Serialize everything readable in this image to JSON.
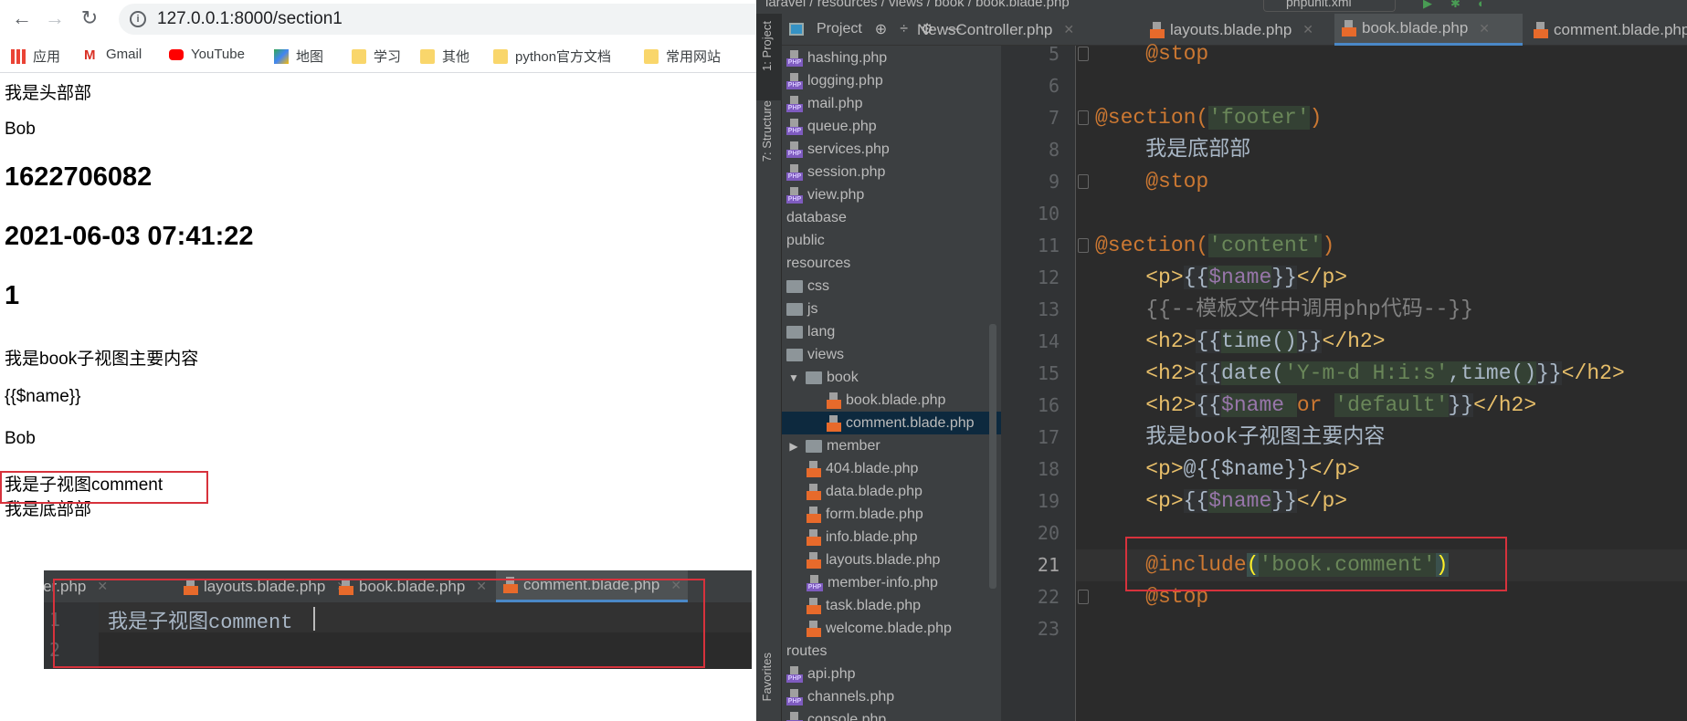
{
  "browser": {
    "url": "127.0.0.1:8000/section1",
    "bookmarks": [
      {
        "label": "应用",
        "icon": "apps-grid-icon"
      },
      {
        "label": "Gmail",
        "icon": "gmail-icon"
      },
      {
        "label": "YouTube",
        "icon": "youtube-icon"
      },
      {
        "label": "地图",
        "icon": "maps-icon"
      },
      {
        "label": "学习",
        "icon": "folder-icon"
      },
      {
        "label": "其他",
        "icon": "folder-icon"
      },
      {
        "label": "python官方文档",
        "icon": "folder-icon"
      },
      {
        "label": "常用网站",
        "icon": "folder-icon"
      }
    ],
    "page": [
      {
        "text": "我是头部部",
        "tag": "p"
      },
      {
        "text": "Bob",
        "tag": "p"
      },
      {
        "text": "1622706082",
        "tag": "h2"
      },
      {
        "text": "2021-06-03 07:41:22",
        "tag": "h2"
      },
      {
        "text": "1",
        "tag": "h2"
      },
      {
        "text": "我是book子视图主要内容",
        "tag": "p"
      },
      {
        "text": "{{$name}}",
        "tag": "p"
      },
      {
        "text": "Bob",
        "tag": "p"
      },
      {
        "text": "我是子视图comment",
        "tag": "p"
      },
      {
        "text": "我是底部部",
        "tag": "p"
      }
    ]
  },
  "snippet": {
    "tabs": [
      {
        "label": "NewsController.php",
        "type": "php"
      },
      {
        "label": "layouts.blade.php",
        "type": "blade"
      },
      {
        "label": "book.blade.php",
        "type": "blade"
      },
      {
        "label": "comment.blade.php",
        "type": "blade",
        "active": true
      }
    ],
    "lines": [
      {
        "num": "1",
        "text": "我是子视图comment"
      },
      {
        "num": "2",
        "text": ""
      }
    ]
  },
  "ide": {
    "breadcrumbs": "laravel / resources / views / book / book.blade.php",
    "run_config": "phpunit.xml",
    "side_tools": [
      "1: Project",
      "7: Structure",
      "Favorites"
    ],
    "pane_title": "Project",
    "tree": [
      {
        "label": "hashing.php",
        "type": "php",
        "depth": 0
      },
      {
        "label": "logging.php",
        "type": "php",
        "depth": 0
      },
      {
        "label": "mail.php",
        "type": "php",
        "depth": 0
      },
      {
        "label": "queue.php",
        "type": "php",
        "depth": 0
      },
      {
        "label": "services.php",
        "type": "php",
        "depth": 0
      },
      {
        "label": "session.php",
        "type": "php",
        "depth": 0
      },
      {
        "label": "view.php",
        "type": "php",
        "depth": 0
      },
      {
        "label": "database",
        "type": "plain",
        "depth": 0
      },
      {
        "label": "public",
        "type": "plain",
        "depth": 0
      },
      {
        "label": "resources",
        "type": "plain",
        "depth": 0
      },
      {
        "label": "css",
        "type": "folder",
        "depth": 0
      },
      {
        "label": "js",
        "type": "folder",
        "depth": 0
      },
      {
        "label": "lang",
        "type": "folder",
        "depth": 0
      },
      {
        "label": "views",
        "type": "folder",
        "depth": 0
      },
      {
        "label": "book",
        "type": "folder",
        "depth": 0,
        "expanded": true
      },
      {
        "label": "book.blade.php",
        "type": "blade",
        "depth": 2
      },
      {
        "label": "comment.blade.php",
        "type": "blade",
        "depth": 2,
        "selected": true
      },
      {
        "label": "member",
        "type": "folder",
        "depth": 0,
        "expanded": false
      },
      {
        "label": "404.blade.php",
        "type": "blade",
        "depth": 1
      },
      {
        "label": "data.blade.php",
        "type": "blade",
        "depth": 1
      },
      {
        "label": "form.blade.php",
        "type": "blade",
        "depth": 1
      },
      {
        "label": "info.blade.php",
        "type": "blade",
        "depth": 1
      },
      {
        "label": "layouts.blade.php",
        "type": "blade",
        "depth": 1
      },
      {
        "label": "member-info.php",
        "type": "php",
        "depth": 1
      },
      {
        "label": "task.blade.php",
        "type": "blade",
        "depth": 1
      },
      {
        "label": "welcome.blade.php",
        "type": "blade",
        "depth": 1
      },
      {
        "label": "routes",
        "type": "plain",
        "depth": 0
      },
      {
        "label": "api.php",
        "type": "php",
        "depth": 0
      },
      {
        "label": "channels.php",
        "type": "php",
        "depth": 0
      },
      {
        "label": "console.php",
        "type": "php",
        "depth": 0
      }
    ],
    "tabs": [
      {
        "label": "NewsController.php",
        "type": "php"
      },
      {
        "label": "layouts.blade.php",
        "type": "blade"
      },
      {
        "label": "book.blade.php",
        "type": "blade",
        "active": true
      },
      {
        "label": "comment.blade.php",
        "type": "blade"
      }
    ],
    "current_line": "21",
    "code": [
      {
        "num": "5",
        "fold": true,
        "tokens": [
          [
            "    ",
            "txt"
          ],
          [
            "@stop",
            "dir"
          ]
        ]
      },
      {
        "num": "6",
        "tokens": []
      },
      {
        "num": "7",
        "fold": true,
        "tokens": [
          [
            "@section(",
            "dir"
          ],
          [
            "'footer'",
            "str"
          ],
          [
            ")",
            "dir"
          ]
        ]
      },
      {
        "num": "8",
        "tokens": [
          [
            "    ",
            "txt"
          ],
          [
            "我是底部部",
            "txt"
          ]
        ]
      },
      {
        "num": "9",
        "fold": true,
        "tokens": [
          [
            "    ",
            "txt"
          ],
          [
            "@stop",
            "dir"
          ]
        ]
      },
      {
        "num": "10",
        "tokens": []
      },
      {
        "num": "11",
        "fold": true,
        "tokens": [
          [
            "@section(",
            "dir"
          ],
          [
            "'content'",
            "str"
          ],
          [
            ")",
            "dir"
          ]
        ]
      },
      {
        "num": "12",
        "tokens": [
          [
            "    ",
            "txt"
          ],
          [
            "<p>",
            "tag"
          ],
          [
            "{{",
            "br"
          ],
          [
            "$name",
            "var"
          ],
          [
            "}}",
            "br"
          ],
          [
            "</p>",
            "tag"
          ]
        ]
      },
      {
        "num": "13",
        "tokens": [
          [
            "    ",
            "txt"
          ],
          [
            "{{--模板文件中调用php代码--}}",
            "cmt"
          ]
        ]
      },
      {
        "num": "14",
        "tokens": [
          [
            "    ",
            "txt"
          ],
          [
            "<h2>",
            "tag"
          ],
          [
            "{{",
            "br"
          ],
          [
            "time()",
            "fn"
          ],
          [
            "}}",
            "br"
          ],
          [
            "</h2>",
            "tag"
          ]
        ]
      },
      {
        "num": "15",
        "tokens": [
          [
            "    ",
            "txt"
          ],
          [
            "<h2>",
            "tag"
          ],
          [
            "{{",
            "br"
          ],
          [
            "date(",
            "fn"
          ],
          [
            "'Y-m-d H:i:s'",
            "str"
          ],
          [
            ",time()",
            "fn"
          ],
          [
            "}}",
            "br"
          ],
          [
            "</h2>",
            "tag"
          ]
        ]
      },
      {
        "num": "16",
        "tokens": [
          [
            "    ",
            "txt"
          ],
          [
            "<h2>",
            "tag"
          ],
          [
            "{{",
            "br"
          ],
          [
            "$name ",
            "var"
          ],
          [
            "or ",
            "dir"
          ],
          [
            "'default'",
            "str"
          ],
          [
            "}}",
            "br"
          ],
          [
            "</h2>",
            "tag"
          ]
        ]
      },
      {
        "num": "17",
        "tokens": [
          [
            "    ",
            "txt"
          ],
          [
            "我是book子视图主要内容",
            "txt"
          ]
        ]
      },
      {
        "num": "18",
        "tokens": [
          [
            "    ",
            "txt"
          ],
          [
            "<p>",
            "tag"
          ],
          [
            "@{{$name}}",
            "txt"
          ],
          [
            "</p>",
            "tag"
          ]
        ]
      },
      {
        "num": "19",
        "tokens": [
          [
            "    ",
            "txt"
          ],
          [
            "<p>",
            "tag"
          ],
          [
            "{{",
            "br"
          ],
          [
            "$name",
            "var"
          ],
          [
            "}}",
            "br"
          ],
          [
            "</p>",
            "tag"
          ]
        ]
      },
      {
        "num": "20",
        "tokens": []
      },
      {
        "num": "21",
        "tokens": [
          [
            "    ",
            "txt"
          ],
          [
            "@include",
            "dir"
          ],
          [
            "(",
            "paren"
          ],
          [
            "'book.comment'",
            "str"
          ],
          [
            ")",
            "paren"
          ]
        ]
      },
      {
        "num": "22",
        "fold": true,
        "tokens": [
          [
            "    ",
            "txt"
          ],
          [
            "@stop",
            "dir"
          ]
        ]
      },
      {
        "num": "23",
        "tokens": []
      }
    ]
  },
  "colors": {
    "highlight_box": "#d7323c",
    "active_tab_underline": "#4a88c7",
    "directive": "#cc7832",
    "string": "#6a8759",
    "tag": "#e8bf6a",
    "variable": "#9876aa"
  }
}
